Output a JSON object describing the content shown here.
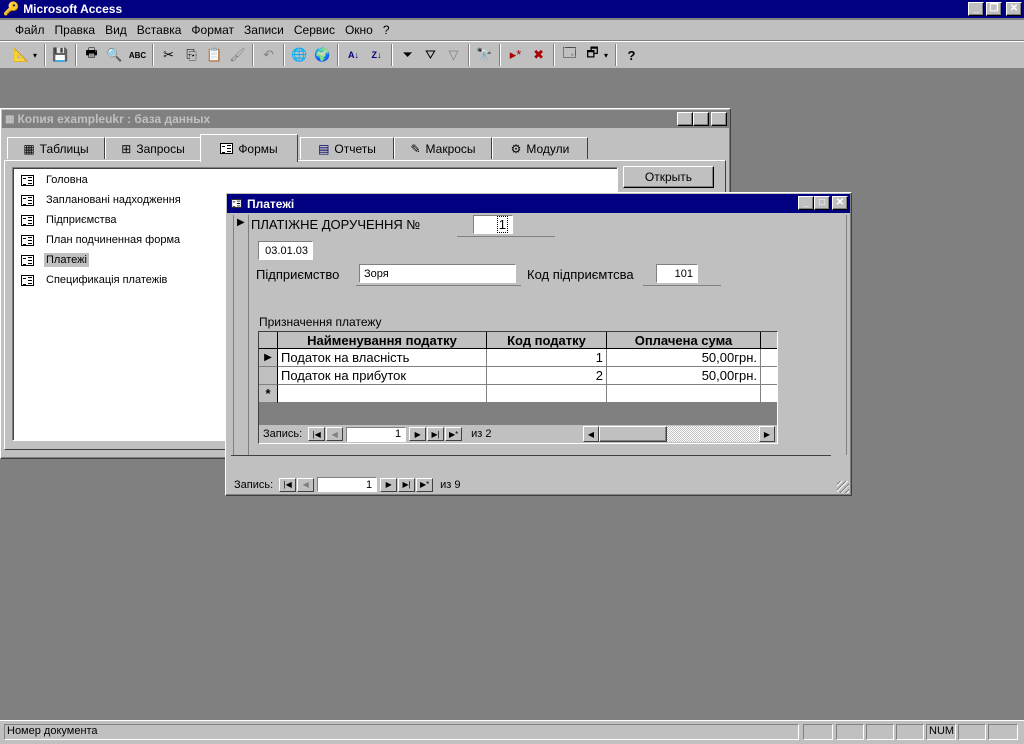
{
  "app": {
    "title": "Microsoft Access"
  },
  "menu": [
    "Файл",
    "Правка",
    "Вид",
    "Вставка",
    "Формат",
    "Записи",
    "Сервис",
    "Окно",
    "?"
  ],
  "toolbar": {
    "icons": [
      "design-view-icon",
      "save-icon",
      "print-icon",
      "print-preview-icon",
      "spelling-icon",
      "cut-icon",
      "copy-icon",
      "paste-icon",
      "format-painter-icon",
      "undo-icon",
      "insert-hyperlink-icon",
      "web-toolbar-icon",
      "sort-ascending-icon",
      "sort-descending-icon",
      "filter-by-selection-icon",
      "filter-by-form-icon",
      "apply-filter-icon",
      "find-icon",
      "new-record-icon",
      "delete-record-icon",
      "database-window-icon",
      "new-object-icon",
      "help-icon"
    ]
  },
  "db_window": {
    "title": "Копия exampleukr : база данных",
    "tabs": [
      "Таблицы",
      "Запросы",
      "Формы",
      "Отчеты",
      "Макросы",
      "Модули"
    ],
    "active_tab": "Формы",
    "items": [
      "Головна",
      "Заплановані надходження",
      "Підприємства",
      "План подчиненная форма",
      "Платежі",
      "Спецификація платежів"
    ],
    "selected_item": "Платежі",
    "open_button": "Открыть"
  },
  "form": {
    "title": "Платежі",
    "doc_label": "ПЛАТІЖНЕ ДОРУЧЕННЯ №",
    "doc_number": "1",
    "date": "03.01.03",
    "company_label": "Підприємство",
    "company_value": "Зоря",
    "company_code_label": "Код підприємтсва",
    "company_code_value": "101",
    "subform_label": "Призначення платежу",
    "columns": [
      "Найменування податку",
      "Код податку",
      "Оплачена сума"
    ],
    "rows": [
      {
        "name": "Податок на власність",
        "code": "1",
        "sum": "50,00грн."
      },
      {
        "name": "Податок на прибуток",
        "code": "2",
        "sum": "50,00грн."
      }
    ],
    "new_row_marker": "*",
    "sub_nav": {
      "label": "Запись:",
      "current": "1",
      "of_text": "из 2"
    },
    "main_nav": {
      "label": "Запись:",
      "current": "1",
      "of_text": "из 9"
    }
  },
  "status": {
    "text": "Номер документа",
    "num": "NUM"
  }
}
